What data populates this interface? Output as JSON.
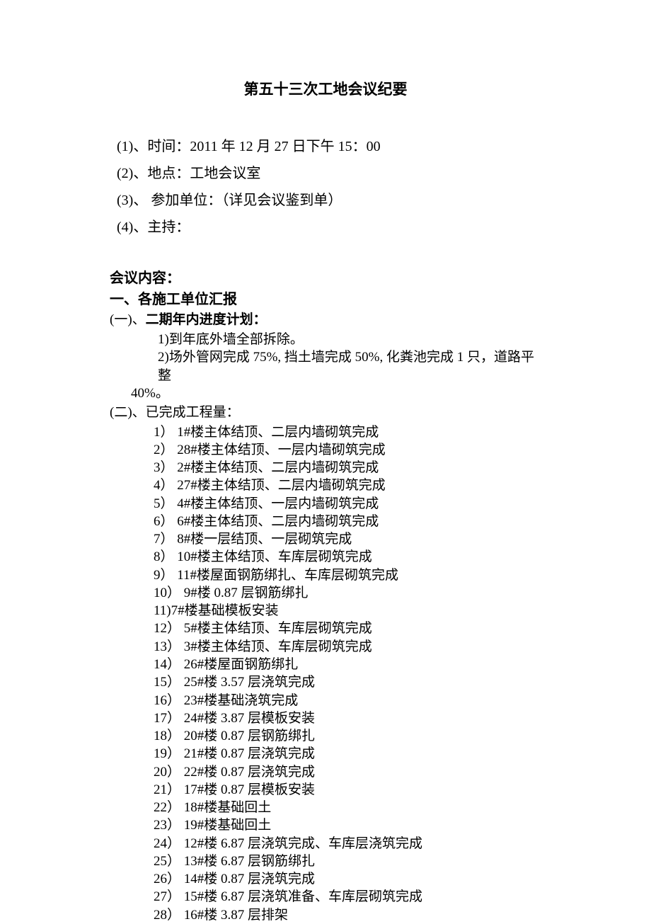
{
  "title": "第五十三次工地会议纪要",
  "meta": {
    "line1": "(1)、时间：2011 年 12 月 27 日下午 15：00",
    "line2": "(2)、地点：工地会议室",
    "line3": "(3)、  参加单位：（详见会议鉴到单）",
    "line4": "(4)、主持："
  },
  "content_header": "会议内容：",
  "section1": "一、各施工单位汇报",
  "sub1_prefix": "(一)、",
  "sub1_title": "二期年内进度计划：",
  "plan": {
    "p1": "1)到年底外墙全部拆除。",
    "p2": "2)场外管网完成 75%, 挡土墙完成 50%, 化粪池完成 1 只，道路平整",
    "p2c": "40%。"
  },
  "sub2": "(二)、已完成工程量：",
  "completed": {
    "i1": "1）  1#楼主体结顶、二层内墙砌筑完成",
    "i2": "2）  28#楼主体结顶、一层内墙砌筑完成",
    "i3": "3）  2#楼主体结顶、二层内墙砌筑完成",
    "i4": "4）  27#楼主体结顶、二层内墙砌筑完成",
    "i5": "5）  4#楼主体结顶、一层内墙砌筑完成",
    "i6": "6）  6#楼主体结顶、二层内墙砌筑完成",
    "i7": "7）  8#楼一层结顶、一层砌筑完成",
    "i8": "8）  10#楼主体结顶、车库层砌筑完成",
    "i9": "9）  11#楼屋面钢筋绑扎、车库层砌筑完成",
    "i10": "10）  9#楼 0.87 层钢筋绑扎",
    "i11": "11)7#楼基础模板安装",
    "i12": "12）  5#楼主体结顶、车库层砌筑完成",
    "i13": "13）  3#楼主体结顶、车库层砌筑完成",
    "i14": "14）  26#楼屋面钢筋绑扎",
    "i15": "15）  25#楼 3.57 层浇筑完成",
    "i16": "16）  23#楼基础浇筑完成",
    "i17": "17）  24#楼 3.87 层模板安装",
    "i18": "18）  20#楼 0.87 层钢筋绑扎",
    "i19": "19）  21#楼 0.87 层浇筑完成",
    "i20": "20）  22#楼 0.87 层浇筑完成",
    "i21": "21）  17#楼 0.87 层模板安装",
    "i22": "22）  18#楼基础回土",
    "i23": "23）  19#楼基础回土",
    "i24": "24）  12#楼 6.87 层浇筑完成、车库层浇筑完成",
    "i25": "25）  13#楼 6.87 层钢筋绑扎",
    "i26": "26）  14#楼 0.87 层浇筑完成",
    "i27": "27）  15#楼 6.87 层浇筑准备、车库层砌筑完成",
    "i28": "28）  16#楼 3.87 层排架"
  }
}
